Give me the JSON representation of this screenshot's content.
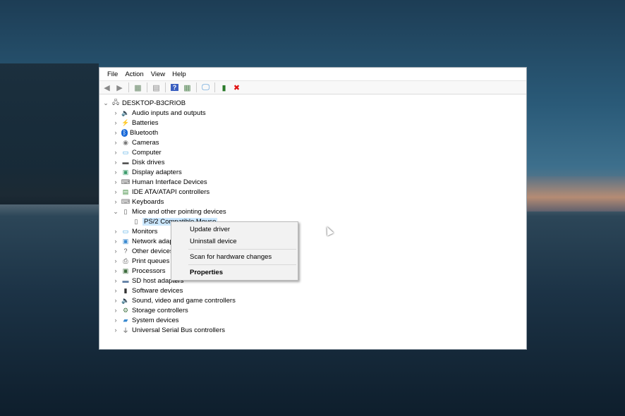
{
  "menu": [
    "File",
    "Action",
    "View",
    "Help"
  ],
  "toolbar": [
    {
      "name": "back-icon",
      "glyph": "◀",
      "color": "#8a8a8a"
    },
    {
      "name": "forward-icon",
      "glyph": "▶",
      "color": "#8a8a8a"
    },
    {
      "sep": true
    },
    {
      "name": "show-hide-console-tree-icon",
      "glyph": "▦",
      "color": "#6a8a6a"
    },
    {
      "sep": true
    },
    {
      "name": "properties-icon",
      "glyph": "▤",
      "color": "#888"
    },
    {
      "sep": true
    },
    {
      "name": "help-icon",
      "glyph": "?",
      "color": "#fff",
      "bg": "#3a5fc0"
    },
    {
      "name": "action-pane-icon",
      "glyph": "▦",
      "color": "#5a8a5a"
    },
    {
      "sep": true
    },
    {
      "name": "scan-hardware-icon",
      "glyph": "🖵",
      "color": "#3a8ad0"
    },
    {
      "sep": true
    },
    {
      "name": "update-driver-icon",
      "glyph": "▮",
      "color": "#2a7a2a"
    },
    {
      "name": "uninstall-icon",
      "glyph": "✖",
      "color": "#e01010"
    }
  ],
  "tree": {
    "root": "DESKTOP-B3CRIOB",
    "items": [
      {
        "label": "Audio inputs and outputs",
        "icon": "speaker-icon",
        "glyph": "🔈",
        "color": "#777"
      },
      {
        "label": "Batteries",
        "icon": "battery-icon",
        "glyph": "⚡",
        "color": "#4a8a2a"
      },
      {
        "label": "Bluetooth",
        "icon": "bluetooth-icon",
        "glyph": "ᛒ",
        "color": "#fff",
        "bg": "#1a6ad8"
      },
      {
        "label": "Cameras",
        "icon": "camera-icon",
        "glyph": "◉",
        "color": "#777"
      },
      {
        "label": "Computer",
        "icon": "computer-icon",
        "glyph": "▭",
        "color": "#3aa0e0"
      },
      {
        "label": "Disk drives",
        "icon": "disk-drive-icon",
        "glyph": "▬",
        "color": "#555"
      },
      {
        "label": "Display adapters",
        "icon": "display-adapter-icon",
        "glyph": "▣",
        "color": "#3a9a6a"
      },
      {
        "label": "Human Interface Devices",
        "icon": "hid-icon",
        "glyph": "⌨",
        "color": "#666"
      },
      {
        "label": "IDE ATA/ATAPI controllers",
        "icon": "ide-controller-icon",
        "glyph": "▤",
        "color": "#3a8a3a"
      },
      {
        "label": "Keyboards",
        "icon": "keyboard-icon",
        "glyph": "⌨",
        "color": "#777"
      },
      {
        "label": "Mice and other pointing devices",
        "icon": "mouse-icon",
        "glyph": "▯",
        "color": "#555",
        "expanded": true,
        "children": [
          {
            "label": "PS/2 Compatible Mouse",
            "icon": "mouse-icon",
            "selected": true
          }
        ]
      },
      {
        "label": "Monitors",
        "icon": "monitor-icon",
        "glyph": "▭",
        "color": "#3aa0e0"
      },
      {
        "label": "Network adapters",
        "icon": "network-adapter-icon",
        "glyph": "▣",
        "color": "#3a8ad0"
      },
      {
        "label": "Other devices",
        "icon": "other-devices-icon",
        "glyph": "?",
        "color": "#555"
      },
      {
        "label": "Print queues",
        "icon": "printer-icon",
        "glyph": "⎙",
        "color": "#555"
      },
      {
        "label": "Processors",
        "icon": "processor-icon",
        "glyph": "▣",
        "color": "#3a6a3a"
      },
      {
        "label": "SD host adapters",
        "icon": "sd-host-icon",
        "glyph": "▬",
        "color": "#5a7aa0"
      },
      {
        "label": "Software devices",
        "icon": "software-device-icon",
        "glyph": "▮",
        "color": "#333"
      },
      {
        "label": "Sound, video and game controllers",
        "icon": "speaker-icon",
        "glyph": "🔈",
        "color": "#777"
      },
      {
        "label": "Storage controllers",
        "icon": "storage-controller-icon",
        "glyph": "⚙",
        "color": "#4a7a4a"
      },
      {
        "label": "System devices",
        "icon": "system-devices-icon",
        "glyph": "▰",
        "color": "#3a8ad0"
      },
      {
        "label": "Universal Serial Bus controllers",
        "icon": "usb-icon",
        "glyph": "⏚",
        "color": "#444"
      }
    ]
  },
  "context_menu": {
    "update": "Update driver",
    "uninstall": "Uninstall device",
    "scan": "Scan for hardware changes",
    "properties": "Properties"
  }
}
